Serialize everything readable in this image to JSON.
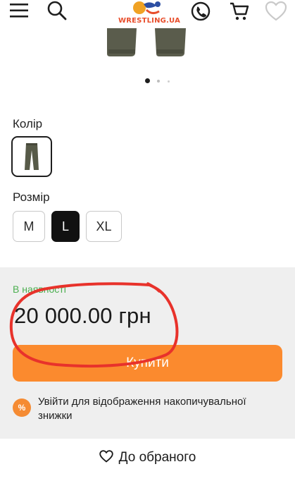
{
  "header": {
    "logo_text": "WRESTLING.UA",
    "icons": [
      "menu-icon",
      "search-icon",
      "phone-icon",
      "cart-icon",
      "heart-icon"
    ]
  },
  "gallery": {
    "dot_count": 3,
    "active_dot": 0
  },
  "color_section": {
    "label": "Колір"
  },
  "size_section": {
    "label": "Розмір",
    "options": [
      "M",
      "L",
      "XL"
    ],
    "selected": "L"
  },
  "purchase": {
    "stock_status": "В наявності",
    "price": "20 000.00 грн",
    "buy_label": "Купити",
    "discount_badge": "%",
    "discount_text": "Увійти для відображення накопичувальної знижки"
  },
  "wishlist": {
    "label": "До обраного"
  },
  "colors": {
    "accent": "#fb8a2e",
    "stock_green": "#4caf50",
    "annotation_red": "#e8322b"
  }
}
